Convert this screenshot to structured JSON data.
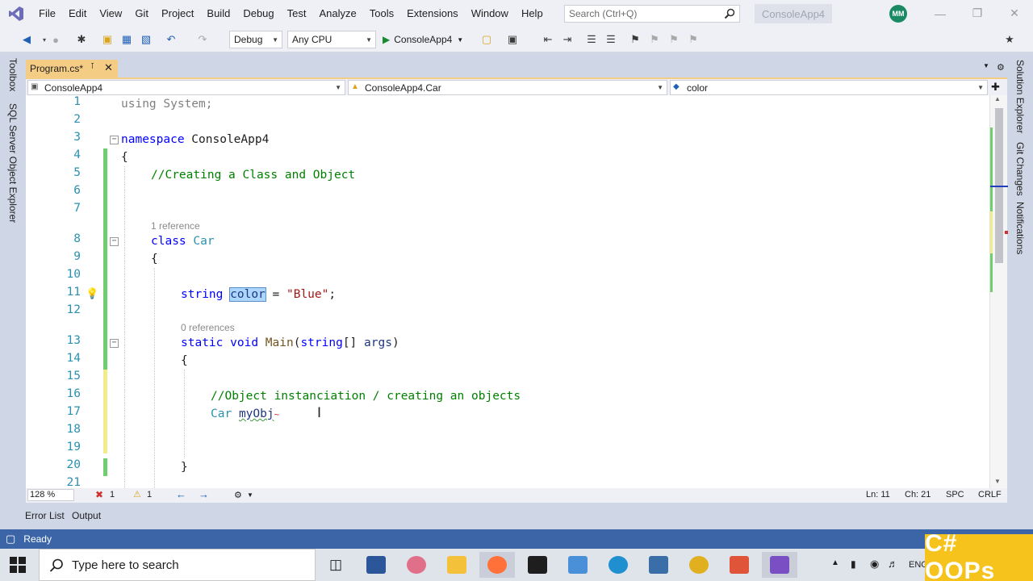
{
  "menu": [
    "File",
    "Edit",
    "View",
    "Git",
    "Project",
    "Build",
    "Debug",
    "Test",
    "Analyze",
    "Tools",
    "Extensions",
    "Window",
    "Help"
  ],
  "search": {
    "placeholder": "Search (Ctrl+Q)"
  },
  "solution_name": "ConsoleApp4",
  "user_initials": "MM",
  "toolbar": {
    "config": "Debug",
    "platform": "Any CPU",
    "start_label": "ConsoleApp4"
  },
  "left_tool_tabs": [
    "Toolbox",
    "SQL Server Object Explorer"
  ],
  "right_tool_tabs": [
    "Solution Explorer",
    "Git Changes",
    "Notifications"
  ],
  "document_tab": {
    "label": "Program.cs*"
  },
  "navbar": {
    "project": "ConsoleApp4",
    "type": "ConsoleApp4.Car",
    "member": "color"
  },
  "line_numbers": [
    "1",
    "2",
    "3",
    "4",
    "5",
    "6",
    "7",
    "8",
    "9",
    "10",
    "11",
    "12",
    "13",
    "14",
    "15",
    "16",
    "17",
    "18",
    "19",
    "20",
    "21"
  ],
  "code": {
    "l1a": "using",
    "l1b": " System;",
    "l3a": "namespace",
    "l3b": " ConsoleApp4",
    "l4": "{",
    "l5": "//Creating a Class and Object",
    "ref8": "1 reference",
    "l8a": "class",
    "l8b": "Car",
    "l9": "{",
    "l11a": "string",
    "l11b": "color",
    "l11c": " = ",
    "l11d": "\"Blue\"",
    "l11e": ";",
    "ref13": "0 references",
    "l13a": "static",
    "l13b": "void",
    "l13c": "Main",
    "l13d": "(",
    "l13e": "string",
    "l13f": "[] ",
    "l13g": "args",
    "l13h": ")",
    "l14": "{",
    "l16": "//Object instanciation / creating an objects",
    "l17a": "Car",
    "l17b": "myObj",
    "l20": "}"
  },
  "editor_bar": {
    "zoom": "128 %",
    "errors": "1",
    "warnings": "1",
    "line": "Ln: 11",
    "col": "Ch: 21",
    "spc": "SPC",
    "eol": "CRLF"
  },
  "tool_window_tabs": [
    "Error List",
    "Output"
  ],
  "status": {
    "text": "Ready"
  },
  "taskbar": {
    "search_placeholder": "Type here to search",
    "tray_lang": "ENG"
  },
  "badge": {
    "text": "C# OOPs"
  },
  "colors": {
    "status_bar": "#3c65a8",
    "active_tab": "#f5cc84",
    "badge": "#f6c21c",
    "keyword": "#0000ff",
    "type": "#2b91af",
    "comment": "#008000",
    "string": "#a31515"
  }
}
